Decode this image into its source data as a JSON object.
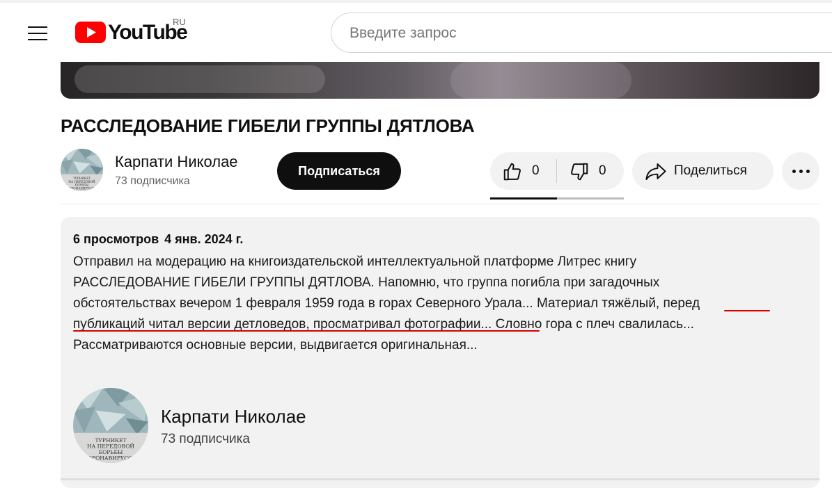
{
  "header": {
    "logo_text": "YouTube",
    "region": "RU",
    "search_placeholder": "Введите запрос"
  },
  "video": {
    "title": "РАССЛЕДОВАНИЕ ГИБЕЛИ ГРУППЫ ДЯТЛОВА"
  },
  "channel": {
    "name": "Карпати Николае",
    "subscribers": "73 подписчика",
    "avatar_text": [
      "ТУРНИКЕТ",
      "НА ПЕРЕДОВОЙ",
      "БОРЬБЫ",
      "КОРОНАВИРУСОМ"
    ]
  },
  "actions": {
    "subscribe_label": "Подписаться",
    "like_count": "0",
    "dislike_count": "0",
    "like_ratio": 0.5,
    "share_label": "Поделиться"
  },
  "description": {
    "views": "6 просмотров",
    "date": "4 янв. 2024 г.",
    "lines": [
      "Отправил на модерацию на книгоиздательской интеллектуальной платформе  Литрес книгу",
      "РАССЛЕДОВАНИЕ ГИБЕЛИ ГРУППЫ ДЯТЛОВА. Напомню, что группа погибла при загадочных",
      "обстоятельствах вечером 1 февраля 1959 года в горах Северного Урала... Материал тяжёлый, перед",
      "публикаций читал версии детловедов, просматривал фотографии... Словно гора с плеч свалилась...",
      "Рассматриваются основные версии, выдвигается оригинальная..."
    ]
  },
  "colors": {
    "brand_red": "#ff0000",
    "underline_red": "#d40000",
    "chip_bg": "#f2f2f2"
  },
  "icons": [
    "menu-icon",
    "youtube-logo-icon",
    "thumbs-up-icon",
    "thumbs-down-icon",
    "share-icon",
    "more-icon"
  ]
}
